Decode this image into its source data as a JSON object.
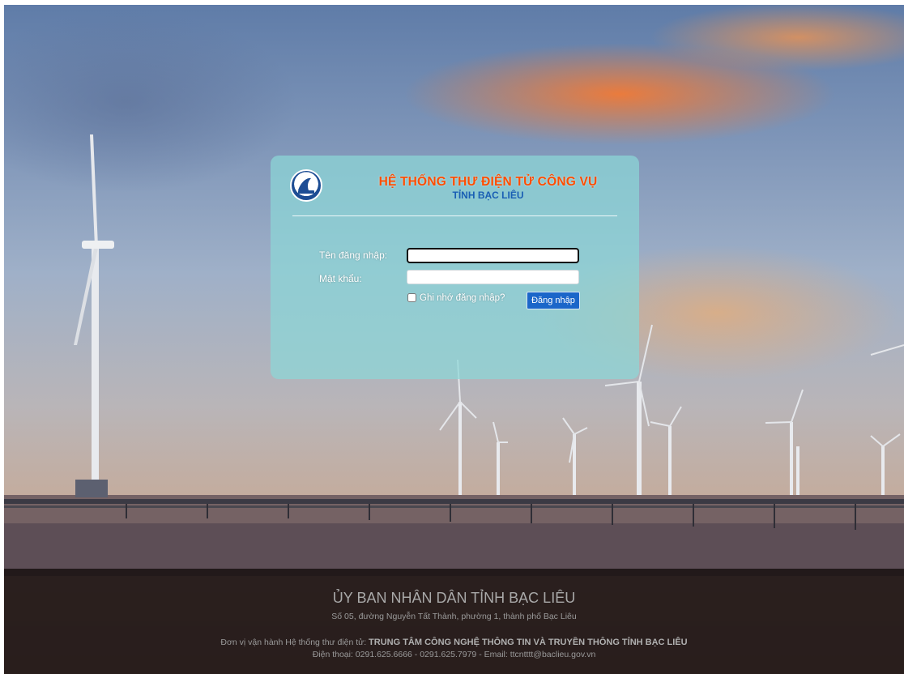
{
  "header": {
    "title_line1": "HỆ THỐNG THƯ ĐIỆN TỬ CÔNG VỤ",
    "title_line2": "TỈNH BẠC LIÊU",
    "logo_icon": "bac-lieu-emblem-icon"
  },
  "login_form": {
    "username_label": "Tên đăng nhập:",
    "username_value": "",
    "password_label": "Mật khẩu:",
    "password_value": "",
    "remember_label": "Ghi nhớ đăng nhập?",
    "remember_checked": false,
    "submit_label": "Đăng nhập"
  },
  "footer": {
    "organization": "ỦY BAN NHÂN DÂN TỈNH BẠC LIÊU",
    "address": "Số 05, đường Nguyễn Tất Thành, phường 1, thành phố Bạc Liêu",
    "operator_prefix": "Đơn vị vận hành Hệ thống thư điện tử: ",
    "operator_name": "TRUNG TÂM CÔNG NGHỆ THÔNG TIN VÀ TRUYỀN THÔNG TỈNH BẠC LIÊU",
    "contact": "Điện thoại: 0291.625.6666 - 0291.625.7979 - Email: ttcntttt@baclieu.gov.vn"
  },
  "colors": {
    "title_orange": "#ff4d00",
    "title_blue": "#1a5fb4",
    "button_blue": "#1b66c9",
    "panel_teal": "#8cd7d7",
    "footer_bg": "#1e1616"
  }
}
